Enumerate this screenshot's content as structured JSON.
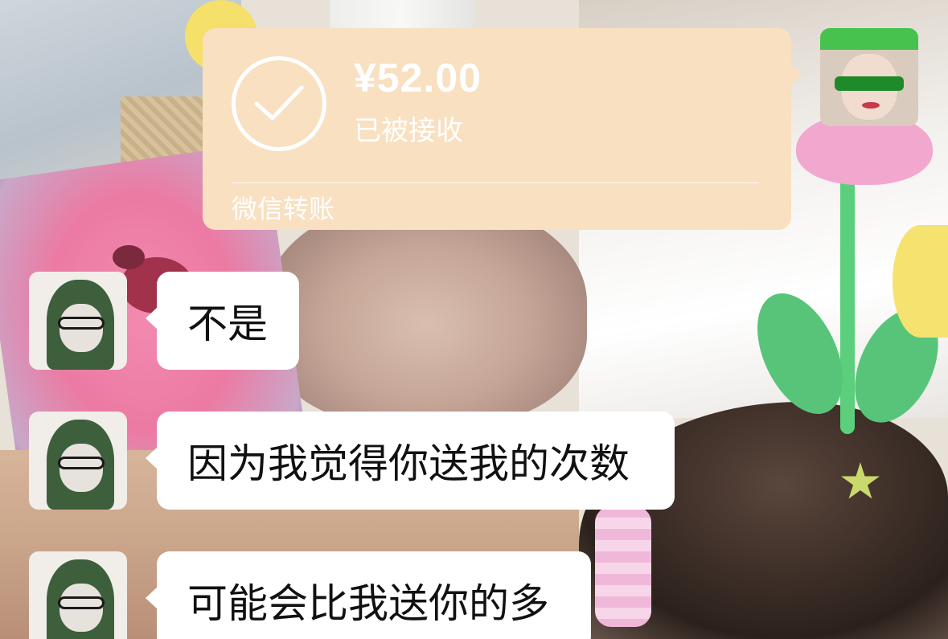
{
  "transfer": {
    "amount": "¥52.00",
    "status": "已被接收",
    "source": "微信转账",
    "check_icon": "check-circle-icon"
  },
  "avatars": {
    "self": "avatar-self",
    "other": "avatar-other"
  },
  "messages": [
    {
      "sender": "other",
      "text": "不是"
    },
    {
      "sender": "other",
      "text": "因为我觉得你送我的次数"
    },
    {
      "sender": "other",
      "text": "可能会比我送你的多"
    }
  ],
  "colors": {
    "transfer_card": "#f8e0c1",
    "bubble": "#ffffff",
    "text": "#111111"
  }
}
